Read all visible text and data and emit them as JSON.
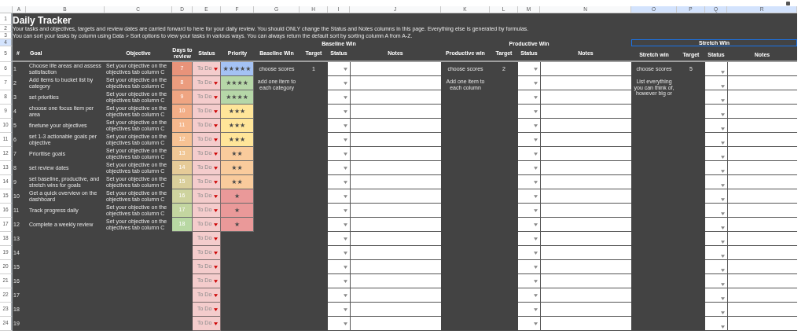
{
  "columns": [
    {
      "label": "A",
      "selected": false
    },
    {
      "label": "B",
      "selected": false
    },
    {
      "label": "C",
      "selected": false
    },
    {
      "label": "D",
      "selected": false
    },
    {
      "label": "E",
      "selected": false
    },
    {
      "label": "F",
      "selected": false
    },
    {
      "label": "G",
      "selected": false
    },
    {
      "label": "H",
      "selected": false
    },
    {
      "label": "I",
      "selected": false
    },
    {
      "label": "J",
      "selected": false
    },
    {
      "label": "K",
      "selected": false
    },
    {
      "label": "L",
      "selected": false
    },
    {
      "label": "M",
      "selected": false
    },
    {
      "label": "N",
      "selected": false
    },
    {
      "label": "O",
      "selected": true
    },
    {
      "label": "P",
      "selected": true
    },
    {
      "label": "Q",
      "selected": true
    },
    {
      "label": "R",
      "selected": true
    }
  ],
  "rows": [
    {
      "label": "1",
      "selected": false
    },
    {
      "label": "2",
      "selected": false
    },
    {
      "label": "3",
      "selected": false
    },
    {
      "label": "4",
      "selected": true
    },
    {
      "label": "5",
      "selected": false
    },
    {
      "label": "6",
      "selected": false
    },
    {
      "label": "7",
      "selected": false
    },
    {
      "label": "8",
      "selected": false
    },
    {
      "label": "9",
      "selected": false
    },
    {
      "label": "10",
      "selected": false
    },
    {
      "label": "11",
      "selected": false
    },
    {
      "label": "12",
      "selected": false
    },
    {
      "label": "13",
      "selected": false
    },
    {
      "label": "14",
      "selected": false
    },
    {
      "label": "15",
      "selected": false
    },
    {
      "label": "16",
      "selected": false
    },
    {
      "label": "17",
      "selected": false
    },
    {
      "label": "18",
      "selected": false
    },
    {
      "label": "19",
      "selected": false
    },
    {
      "label": "20",
      "selected": false
    },
    {
      "label": "21",
      "selected": false
    },
    {
      "label": "22",
      "selected": false
    },
    {
      "label": "23",
      "selected": false
    },
    {
      "label": "24",
      "selected": false
    }
  ],
  "title": "Daily Tracker",
  "notes": [
    "Your tasks and objectives, targets and review dates are carried forward to here for your daily review. You should ONLY change the Status and Notes columns in this page. Everything else is generated by formulas.",
    "You can sort your tasks by column using Data > Sort options to view your tasks in various ways. You can always return the default sort by sorting column A from A-Z."
  ],
  "group_headers": [
    {
      "label": "Baseline Win",
      "selected": false
    },
    {
      "label": "Productive Win",
      "selected": false
    },
    {
      "label": "Stretch Win",
      "selected": true
    }
  ],
  "table_headers": [
    "#",
    "Goal",
    "Objective",
    "Days to review",
    "Status",
    "Priority",
    "Baseline Win",
    "Target",
    "Status",
    "Notes",
    "Productive win",
    "Target",
    "Status",
    "Notes",
    "Stretch win",
    "Target",
    "Status",
    "Notes"
  ],
  "tasks": [
    {
      "number": "1",
      "goal": "Choose life areas and assess satisfaction",
      "objective": "Set your objective on the objectives tab column C",
      "days": "7",
      "color": "#e8937a",
      "status": "To Do",
      "priority": {
        "text": "★★★★★",
        "color": "#a4c2f4"
      }
    },
    {
      "number": "2",
      "goal": "Add items to bucket list by category",
      "objective": "Set your objective on the objectives tab column C",
      "days": "8",
      "color": "#eb9c7e",
      "status": "To Do",
      "priority": {
        "text": "★★★★",
        "color": "#b6d7a8"
      }
    },
    {
      "number": "3",
      "goal": "set priorities",
      "objective": "Set your objective on the objectives tab column C",
      "days": "9",
      "color": "#efa582",
      "status": "To Do",
      "priority": {
        "text": "★★★★",
        "color": "#b6d7a8"
      }
    },
    {
      "number": "4",
      "goal": "choose one focus item per area",
      "objective": "Set your objective on the objectives tab column C",
      "days": "10",
      "color": "#f3ae87",
      "status": "To Do",
      "priority": {
        "text": "★★★",
        "color": "#ffe599"
      }
    },
    {
      "number": "5",
      "goal": "finetune your objectives",
      "objective": "Set your objective on the objectives tab column C",
      "days": "11",
      "color": "#f6b88d",
      "status": "To Do",
      "priority": {
        "text": "★★★",
        "color": "#ffe599"
      }
    },
    {
      "number": "6",
      "goal": "set 1-3 actionable goals per objective",
      "objective": "Set your objective on the objectives tab column C",
      "days": "12",
      "color": "#f7c293",
      "status": "To Do",
      "priority": {
        "text": "★★★",
        "color": "#ffe599"
      }
    },
    {
      "number": "7",
      "goal": "Prioritise goals",
      "objective": "Set your objective on the objectives tab column C",
      "days": "13",
      "color": "#f1c795",
      "status": "To Do",
      "priority": {
        "text": "★★",
        "color": "#f9cb9c"
      }
    },
    {
      "number": "8",
      "goal": "set review dates",
      "objective": "Set your objective on the objectives tab column C",
      "days": "14",
      "color": "#e6cb98",
      "status": "To Do",
      "priority": {
        "text": "★★",
        "color": "#f9cb9c"
      }
    },
    {
      "number": "9",
      "goal": "set baseline, productive, and stretch wins for goals",
      "objective": "Set your objective on the objectives tab column C",
      "days": "15",
      "color": "#dacf9b",
      "status": "To Do",
      "priority": {
        "text": "★★",
        "color": "#f9cb9c"
      }
    },
    {
      "number": "10",
      "goal": "Get a quick overview on the dashboard",
      "objective": "Set your objective on the objectives tab column C",
      "days": "16",
      "color": "#ced39e",
      "status": "To Do",
      "priority": {
        "text": "★",
        "color": "#ea9999"
      }
    },
    {
      "number": "11",
      "goal": "Track progress daily",
      "objective": "Set your objective on the objectives tab column C",
      "days": "17",
      "color": "#c3d6a0",
      "status": "To Do",
      "priority": {
        "text": "★",
        "color": "#ea9999"
      }
    },
    {
      "number": "12",
      "goal": "Complete a weekly review",
      "objective": "Set your objective on the objectives tab column C",
      "days": "18",
      "color": "#b8d8a3",
      "status": "To Do",
      "priority": {
        "text": "★",
        "color": "#ea9999"
      }
    },
    {
      "number": "13",
      "status": "To Do"
    },
    {
      "number": "14",
      "status": "To Do"
    },
    {
      "number": "15",
      "status": "To Do"
    },
    {
      "number": "16",
      "status": "To Do"
    },
    {
      "number": "17",
      "status": "To Do"
    },
    {
      "number": "18",
      "status": "To Do"
    },
    {
      "number": "19",
      "status": "To Do"
    }
  ],
  "baseline_wins": [
    {
      "text": "choose scores",
      "target": "1"
    },
    {
      "text": "add one item to each category"
    }
  ],
  "productive_wins": [
    {
      "text": "choose scores",
      "target": "2"
    },
    {
      "text": "Add one item to each column"
    }
  ],
  "stretch_wins": [
    {
      "text": "choose scores",
      "target": "5"
    },
    {
      "text": "List everything you can think of, however big or"
    }
  ]
}
